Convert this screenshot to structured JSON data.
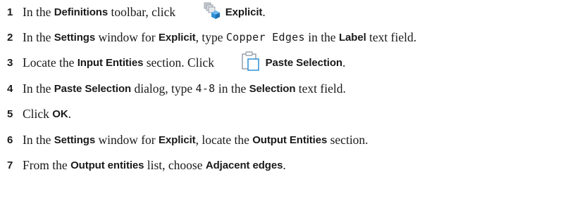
{
  "steps": [
    {
      "number": "1",
      "t1": "In the ",
      "toolbar": "Definitions",
      "t2": " toolbar, click ",
      "icon": "explicit-selection-icon",
      "button": "Explicit",
      "t3": "."
    },
    {
      "number": "2",
      "t1": "In the ",
      "window": "Settings",
      "t2": " window for ",
      "node": "Explicit",
      "t3": ", type ",
      "value": "Copper Edges",
      "t4": " in the ",
      "field": "Label",
      "t5": " text field."
    },
    {
      "number": "3",
      "t1": "Locate the ",
      "section": "Input Entities",
      "t2": " section. Click ",
      "icon": "paste-selection-icon",
      "button": "Paste Selection",
      "t3": "."
    },
    {
      "number": "4",
      "t1": "In the ",
      "dialog": "Paste Selection",
      "t2": " dialog, type ",
      "value": "4-8",
      "t3": " in the ",
      "field": "Selection",
      "t4": " text field."
    },
    {
      "number": "5",
      "t1": "Click ",
      "button": "OK",
      "t2": "."
    },
    {
      "number": "6",
      "t1": "In the ",
      "window": "Settings",
      "t2": " window for ",
      "node": "Explicit",
      "t3": ", locate the ",
      "section": "Output Entities",
      "t4": " section."
    },
    {
      "number": "7",
      "t1": "From the ",
      "list": "Output entities",
      "t2": " list, choose ",
      "option": "Adjacent edges",
      "t3": "."
    }
  ],
  "colors": {
    "text": "#1a1a1a",
    "icon_blue": "#2e8fd6",
    "icon_gray": "#9aa3ad"
  }
}
